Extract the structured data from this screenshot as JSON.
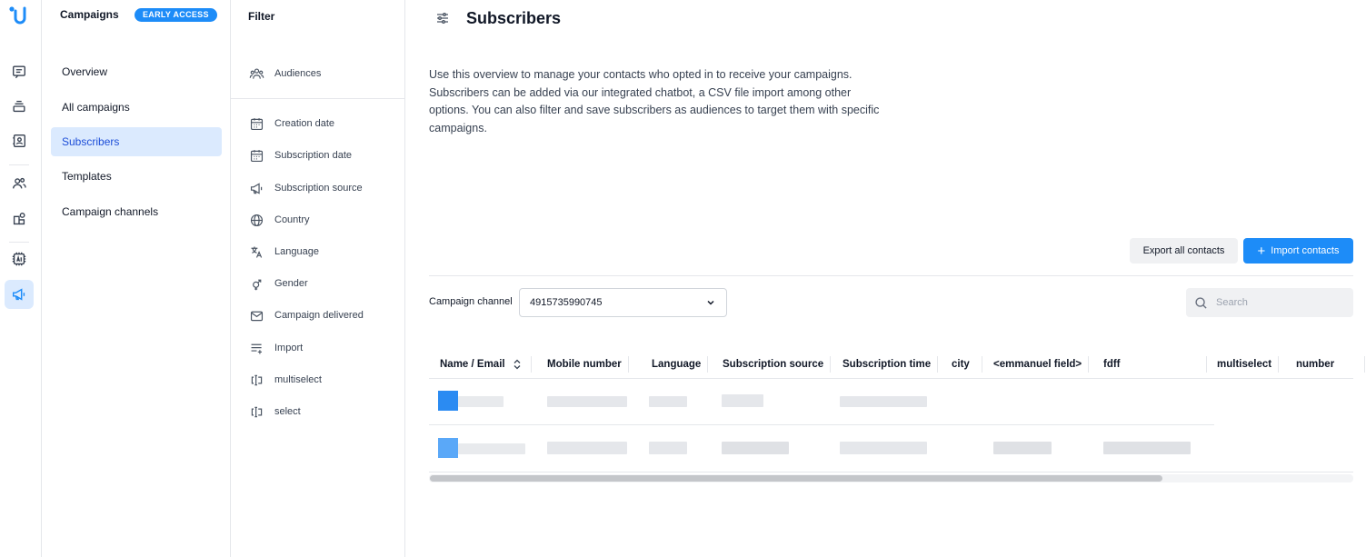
{
  "rail": {
    "icons": [
      "chat-icon",
      "layers-icon",
      "contact-book-icon",
      "users-icon",
      "integrations-icon",
      "ai-chip-icon",
      "megaphone-icon"
    ],
    "accent": "#1d8cf8"
  },
  "nav": {
    "title": "Campaigns",
    "badge": "EARLY ACCESS",
    "items": [
      {
        "label": "Overview",
        "active": false
      },
      {
        "label": "All campaigns",
        "active": false
      },
      {
        "label": "Subscribers",
        "active": true
      },
      {
        "label": "Templates",
        "active": false
      },
      {
        "label": "Campaign channels",
        "active": false
      }
    ]
  },
  "filter": {
    "title": "Filter",
    "items": [
      {
        "label": "Audiences",
        "icon": "users-icon"
      },
      {
        "label": "Creation date",
        "icon": "calendar-icon"
      },
      {
        "label": "Subscription date",
        "icon": "calendar-icon"
      },
      {
        "label": "Subscription source",
        "icon": "megaphone-icon"
      },
      {
        "label": "Country",
        "icon": "globe-icon"
      },
      {
        "label": "Language",
        "icon": "translate-icon"
      },
      {
        "label": "Gender",
        "icon": "gender-icon"
      },
      {
        "label": "Campaign delivered",
        "icon": "envelope-icon"
      },
      {
        "label": "Import",
        "icon": "list-add-icon"
      },
      {
        "label": "multiselect",
        "icon": "input-field-icon"
      },
      {
        "label": "select",
        "icon": "input-field-icon"
      }
    ]
  },
  "main": {
    "title": "Subscribers",
    "description": "Use this overview to manage your contacts who opted in to receive your campaigns. Subscribers can be added via our integrated chatbot, a CSV file import among other options. You can also filter and save subscribers as audiences to target them with specific campaigns.",
    "export_label": "Export all contacts",
    "import_label": "Import contacts",
    "channel_label": "Campaign channel",
    "channel_value": "4915735990745",
    "search_placeholder": "Search",
    "columns": [
      "Name / Email",
      "Mobile number",
      "Language",
      "Subscription source",
      "Subscription time",
      "city",
      "<emmanuel field>",
      "fdff",
      "multiselect",
      "number"
    ]
  }
}
